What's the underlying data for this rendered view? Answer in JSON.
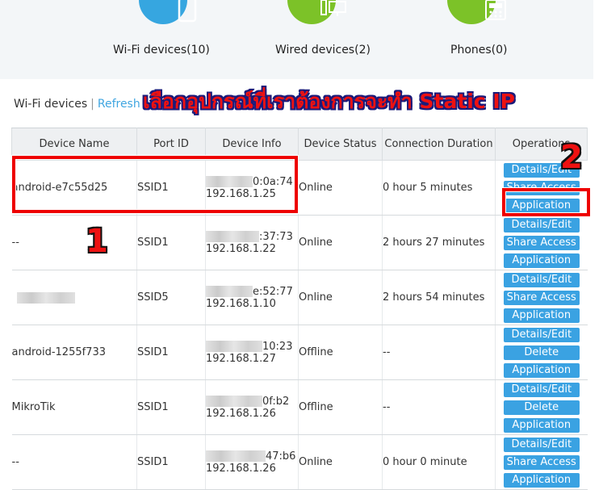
{
  "categories": [
    {
      "label": "Wi-Fi devices(10)",
      "icon": "mobile-phone-icon",
      "color": "#36a6e0"
    },
    {
      "label": "Wired devices(2)",
      "icon": "computer-monitor-icon",
      "color": "#7cc228"
    },
    {
      "label": "Phones(0)",
      "icon": "telephone-icon",
      "color": "#7cc228"
    }
  ],
  "section": {
    "title": "Wi-Fi devices",
    "separator": "|",
    "refresh": "Refresh"
  },
  "annotation": {
    "thai_text": "เลือกอุปกรณ์ที่เราต้องการจะทำ Static IP",
    "marker1": "1",
    "marker2": "2"
  },
  "table": {
    "headers": [
      "Device Name",
      "Port ID",
      "Device Info",
      "Device Status",
      "Connection Duration",
      "Operations"
    ],
    "rows": [
      {
        "name": "android-e7c55d25",
        "port": "SSID1",
        "mac_tail": "0:0a:74",
        "ip": "192.168.1.25",
        "status": "Online",
        "duration": "0 hour 5 minutes",
        "ops": [
          "Details/Edit",
          "Share Access",
          "Application"
        ]
      },
      {
        "name": "--",
        "port": "SSID1",
        "mac_tail": ":37:73",
        "ip": "192.168.1.22",
        "status": "Online",
        "duration": "2 hours 27 minutes",
        "ops": [
          "Details/Edit",
          "Share Access",
          "Application"
        ]
      },
      {
        "name": "",
        "port": "SSID5",
        "mac_tail": "e:52:77",
        "ip": "192.168.1.10",
        "status": "Online",
        "duration": "2 hours 54 minutes",
        "ops": [
          "Details/Edit",
          "Share Access",
          "Application"
        ]
      },
      {
        "name": "android-1255f733",
        "port": "SSID1",
        "mac_tail": "10:23",
        "ip": "192.168.1.27",
        "status": "Offline",
        "duration": "--",
        "ops": [
          "Details/Edit",
          "Delete",
          "Application"
        ]
      },
      {
        "name": "MikroTik",
        "port": "SSID1",
        "mac_tail": "0f:b2",
        "ip": "192.168.1.26",
        "status": "Offline",
        "duration": "--",
        "ops": [
          "Details/Edit",
          "Delete",
          "Application"
        ]
      },
      {
        "name": "--",
        "port": "SSID1",
        "mac_tail": "47:b6",
        "ip": "192.168.1.26",
        "status": "Online",
        "duration": "0 hour 0 minute",
        "ops": [
          "Details/Edit",
          "Share Access",
          "Application"
        ]
      }
    ]
  }
}
